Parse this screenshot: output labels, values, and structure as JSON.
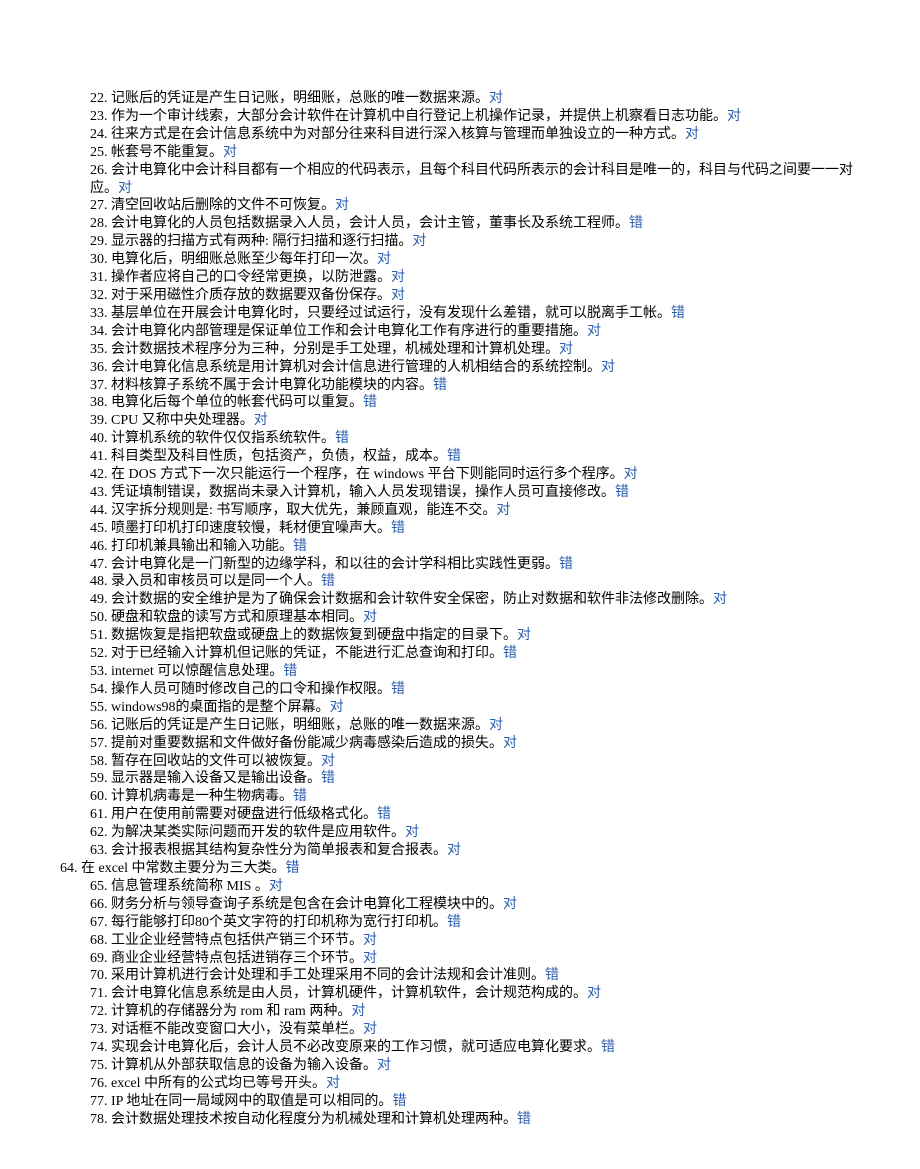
{
  "items": [
    {
      "num": "22.",
      "text": "记账后的凭证是产生日记账，明细账，总账的唯一数据来源。",
      "answer": "对",
      "special": false
    },
    {
      "num": "23.",
      "text": "作为一个审计线索，大部分会计软件在计算机中自行登记上机操作记录，并提供上机察看日志功能。",
      "answer": "对",
      "special": false
    },
    {
      "num": "24.",
      "text": "往来方式是在会计信息系统中为对部分往来科目进行深入核算与管理而单独设立的一种方式。",
      "answer": "对",
      "special": false
    },
    {
      "num": "25.",
      "text": "帐套号不能重复。",
      "answer": "对",
      "special": false
    },
    {
      "num": "26.",
      "text": "会计电算化中会计科目都有一个相应的代码表示，且每个科目代码所表示的会计科目是唯一的，科目与代码之间要一一对应。",
      "answer": "对",
      "special": false
    },
    {
      "num": "27.",
      "text": "清空回收站后删除的文件不可恢复。",
      "answer": "对",
      "special": false
    },
    {
      "num": "28.",
      "text": "会计电算化的人员包括数据录入人员，会计人员，会计主管，董事长及系统工程师。",
      "answer": "错",
      "special": false
    },
    {
      "num": "29.",
      "text": "显示器的扫描方式有两种: 隔行扫描和逐行扫描。",
      "answer": "对",
      "special": false
    },
    {
      "num": "30.",
      "text": "电算化后，明细账总账至少每年打印一次。",
      "answer": "对",
      "special": false
    },
    {
      "num": "31.",
      "text": "操作者应将自己的口令经常更换，以防泄露。",
      "answer": "对",
      "special": false
    },
    {
      "num": "32.",
      "text": "对于采用磁性介质存放的数据要双备份保存。",
      "answer": "对",
      "special": false
    },
    {
      "num": "33.",
      "text": "基层单位在开展会计电算化时，只要经过试运行，没有发现什么差错，就可以脱离手工帐。",
      "answer": "错",
      "special": false
    },
    {
      "num": "34.",
      "text": "会计电算化内部管理是保证单位工作和会计电算化工作有序进行的重要措施。",
      "answer": "对",
      "special": false
    },
    {
      "num": "35.",
      "text": "会计数据技术程序分为三种，分别是手工处理，机械处理和计算机处理。",
      "answer": "对",
      "special": false
    },
    {
      "num": "36.",
      "text": "会计电算化信息系统是用计算机对会计信息进行管理的人机相结合的系统控制。",
      "answer": "对",
      "special": false
    },
    {
      "num": "37.",
      "text": "材料核算子系统不属于会计电算化功能模块的内容。",
      "answer": "错",
      "special": false
    },
    {
      "num": "38.",
      "text": "电算化后每个单位的帐套代码可以重复。",
      "answer": "错",
      "special": false
    },
    {
      "num": "39.",
      "text": "CPU 又称中央处理器。",
      "answer": "对",
      "special": false
    },
    {
      "num": "40.",
      "text": "计算机系统的软件仅仅指系统软件。",
      "answer": "错",
      "special": false
    },
    {
      "num": "41.",
      "text": "科目类型及科目性质，包括资产，负债，权益，成本。",
      "answer": "错",
      "special": false
    },
    {
      "num": "42.",
      "text": "在 DOS 方式下一次只能运行一个程序，在 windows 平台下则能同时运行多个程序。",
      "answer": "对",
      "special": false
    },
    {
      "num": "43.",
      "text": "凭证填制错误，数据尚未录入计算机，输入人员发现错误，操作人员可直接修改。",
      "answer": "错",
      "special": false
    },
    {
      "num": "44.",
      "text": "汉字拆分规则是: 书写顺序，取大优先，兼顾直观，能连不交。",
      "answer": "对",
      "special": false
    },
    {
      "num": "45.",
      "text": "喷墨打印机打印速度较慢，耗材便宜噪声大。",
      "answer": "错",
      "special": false
    },
    {
      "num": "46.",
      "text": "打印机兼具输出和输入功能。",
      "answer": "错",
      "special": false
    },
    {
      "num": "47.",
      "text": "会计电算化是一门新型的边缘学科，和以往的会计学科相比实践性更弱。",
      "answer": "错",
      "special": false
    },
    {
      "num": "48.",
      "text": "录入员和审核员可以是同一个人。",
      "answer": "错",
      "special": false
    },
    {
      "num": "49.",
      "text": "会计数据的安全维护是为了确保会计数据和会计软件安全保密，防止对数据和软件非法修改删除。",
      "answer": "对",
      "special": false
    },
    {
      "num": "50.",
      "text": "硬盘和软盘的读写方式和原理基本相同。",
      "answer": "对",
      "special": false
    },
    {
      "num": "51.",
      "text": "数据恢复是指把软盘或硬盘上的数据恢复到硬盘中指定的目录下。",
      "answer": "对",
      "special": false
    },
    {
      "num": "52.",
      "text": "对于已经输入计算机但记账的凭证，不能进行汇总查询和打印。",
      "answer": "错",
      "special": false
    },
    {
      "num": "53.",
      "text": "internet 可以惊醒信息处理。",
      "answer": "错",
      "special": false
    },
    {
      "num": "54.",
      "text": "操作人员可随时修改自己的口令和操作权限。",
      "answer": "错",
      "special": false
    },
    {
      "num": "55.",
      "text": "windows98的桌面指的是整个屏幕。",
      "answer": "对",
      "special": false
    },
    {
      "num": "56.",
      "text": "记账后的凭证是产生日记账，明细账，总账的唯一数据来源。",
      "answer": "对",
      "special": false
    },
    {
      "num": "57.",
      "text": "提前对重要数据和文件做好备份能减少病毒感染后造成的损失。",
      "answer": "对",
      "special": false
    },
    {
      "num": "58.",
      "text": "暂存在回收站的文件可以被恢复。",
      "answer": "对",
      "special": false
    },
    {
      "num": "59.",
      "text": "显示器是输入设备又是输出设备。",
      "answer": "错",
      "special": false
    },
    {
      "num": "60.",
      "text": "计算机病毒是一种生物病毒。",
      "answer": "错",
      "special": false
    },
    {
      "num": "61.",
      "text": "用户在使用前需要对硬盘进行低级格式化。",
      "answer": "错",
      "special": false
    },
    {
      "num": "62.",
      "text": "为解决某类实际问题而开发的软件是应用软件。",
      "answer": "对",
      "special": false
    },
    {
      "num": "63.",
      "text": "会计报表根据其结构复杂性分为简单报表和复合报表。",
      "answer": "对",
      "special": false
    },
    {
      "num": "64.",
      "text": "在 excel 中常数主要分为三大类。",
      "answer": "错",
      "special": true
    },
    {
      "num": "65.",
      "text": "信息管理系统简称 MIS 。",
      "answer": "对",
      "special": false
    },
    {
      "num": "66.",
      "text": "财务分析与领导查询子系统是包含在会计电算化工程模块中的。",
      "answer": "对",
      "special": false
    },
    {
      "num": "67.",
      "text": "每行能够打印80个英文字符的打印机称为宽行打印机。",
      "answer": "错",
      "special": false
    },
    {
      "num": "68.",
      "text": "工业企业经营特点包括供产销三个环节。",
      "answer": "对",
      "special": false
    },
    {
      "num": "69.",
      "text": "商业企业经营特点包括进销存三个环节。",
      "answer": "对",
      "special": false
    },
    {
      "num": "70.",
      "text": "采用计算机进行会计处理和手工处理采用不同的会计法规和会计准则。",
      "answer": "错",
      "special": false
    },
    {
      "num": "71.",
      "text": "会计电算化信息系统是由人员，计算机硬件，计算机软件，会计规范构成的。",
      "answer": "对",
      "special": false
    },
    {
      "num": "72.",
      "text": "计算机的存储器分为 rom 和 ram 两种。",
      "answer": "对",
      "special": false
    },
    {
      "num": "73.",
      "text": "对话框不能改变窗口大小，没有菜单栏。",
      "answer": "对",
      "special": false
    },
    {
      "num": "74.",
      "text": "实现会计电算化后，会计人员不必改变原来的工作习惯，就可适应电算化要求。",
      "answer": "错",
      "special": false
    },
    {
      "num": "75.",
      "text": "计算机从外部获取信息的设备为输入设备。",
      "answer": "对",
      "special": false
    },
    {
      "num": "76.",
      "text": "excel 中所有的公式均已等号开头。",
      "answer": "对",
      "special": false
    },
    {
      "num": "77.",
      "text": "IP 地址在同一局域网中的取值是可以相同的。",
      "answer": "错",
      "special": false
    },
    {
      "num": "78.",
      "text": "会计数据处理技术按自动化程度分为机械处理和计算机处理两种。",
      "answer": "错",
      "special": false
    }
  ]
}
